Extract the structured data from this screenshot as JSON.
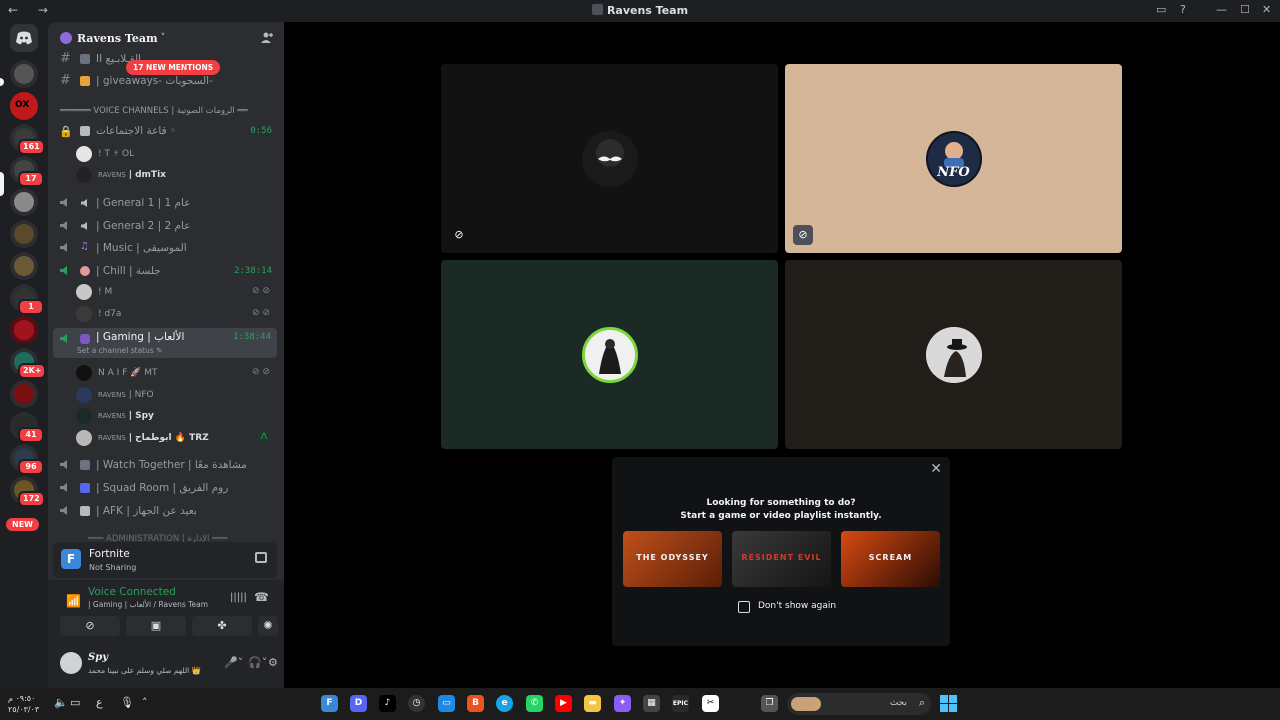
{
  "window": {
    "title": "Ravens Team",
    "nav_arrows": "← →"
  },
  "rail": {
    "home_icon": "discord-logo-icon",
    "badges": [
      "161",
      "17",
      "1",
      "2K+",
      "41",
      "96",
      "172"
    ],
    "new_label": "NEW"
  },
  "server": {
    "name": "Ravens Team",
    "chevron": "˅",
    "invite_icon": "add-user-icon",
    "new_mentions": "17 NEW MENTIONS"
  },
  "channels": {
    "text1": "II القِـلابـيع",
    "text2": "| giveaways-  السحوبات-",
    "voice_category": "══════ VOICE CHANNELS | الرومات الصوتية ══",
    "meeting": "قاعة الاجتماعات  ◦",
    "meeting_time": "0:56",
    "meeting_users": [
      {
        "prefix": "",
        "name": "! T  ⚡ OL"
      },
      {
        "prefix": "RAVENS",
        "name": "| dmTix"
      }
    ],
    "general1": "| General 1 | عام 1",
    "general2": "| General 2 | عام 2",
    "music": "| Music | الموسيقى",
    "chill": "| Chill | جلسة",
    "chill_time": "2:38:14",
    "chill_users": [
      {
        "prefix": "",
        "name": "! M"
      },
      {
        "prefix": "",
        "name": "! d7a"
      }
    ],
    "gaming": "| Gaming | الألعاب",
    "gaming_time": "1:38:44",
    "gaming_status": "Set a channel status ✎",
    "gaming_users": [
      {
        "prefix": "",
        "name": "N A I F  🚀 MT"
      },
      {
        "prefix": "RAVENS",
        "name": "| NFO"
      },
      {
        "prefix": "RAVENS",
        "name": "| Spy"
      },
      {
        "prefix": "RAVENS",
        "name": "| ابوطماح  🔥 TRZ"
      }
    ],
    "watch": "| Watch Together | مشاهدة معًا",
    "squad": "| Squad Room | روم الفريق",
    "afk": "| AFK | بعيد عن الجهاز",
    "admin_category": "═══ ADMINISTRATION | الإدارة ═══"
  },
  "activity": {
    "game": "Fortnite",
    "status": "Not Sharing"
  },
  "voice": {
    "title": "Voice Connected",
    "subtitle": "| Gaming | الألعاب / Ravens Team"
  },
  "user": {
    "name": "Spy",
    "status": "اللهم صلي وسلم على نبينا محمد 👑"
  },
  "stage": {
    "tiles": [
      {
        "name": "tile-user-1",
        "bg": "#121212",
        "muted": true
      },
      {
        "name": "tile-user-nfo",
        "bg": "#d5b699",
        "muted": true,
        "avatar_text": "NFO"
      },
      {
        "name": "tile-user-3",
        "bg": "#1c2a26",
        "muted": false
      },
      {
        "name": "tile-user-4",
        "bg": "#211d19",
        "muted": false
      }
    ]
  },
  "activity_panel": {
    "line1": "Looking for something to do?",
    "line2": "Start a game or video playlist instantly.",
    "cards": [
      "THE ODYSSEY",
      "RESIDENT EVIL",
      "SCREAM"
    ],
    "checkbox_label": "Don't show again"
  },
  "taskbar": {
    "clock_time": "٠٩:٥٠ م",
    "clock_date": "٢٥/٠٣/٠٣",
    "lang": "ع",
    "search_text": "بحث"
  },
  "colors": {
    "accent_green": "#23a559",
    "mention_red": "#f23f43",
    "sidebar_bg": "#2b2d31"
  }
}
